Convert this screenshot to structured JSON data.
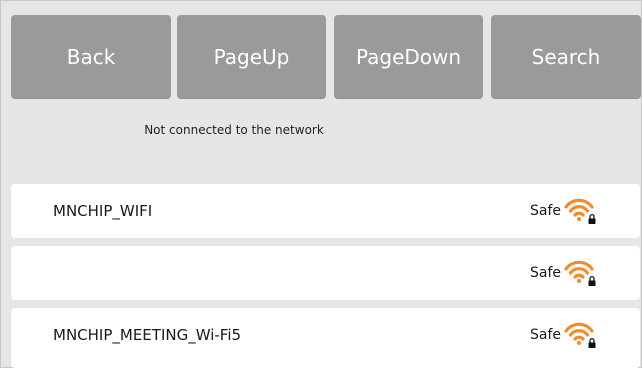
{
  "toolbar": {
    "back_label": "Back",
    "pageup_label": "PageUp",
    "pagedown_label": "PageDown",
    "search_label": "Search"
  },
  "status_text": "Not connected to the network",
  "networks": [
    {
      "ssid": "MNCHIP_WIFI",
      "security": "Safe",
      "icon": "wifi-locked-icon"
    },
    {
      "ssid": "",
      "security": "Safe",
      "icon": "wifi-locked-icon"
    },
    {
      "ssid": "MNCHIP_MEETING_Wi-Fi5",
      "security": "Safe",
      "icon": "wifi-locked-icon"
    }
  ],
  "colors": {
    "button_bg": "#9a9a9a",
    "button_text": "#ffffff",
    "background": "#e6e6e6",
    "row_bg": "#ffffff",
    "wifi_orange": "#f28a2e"
  }
}
